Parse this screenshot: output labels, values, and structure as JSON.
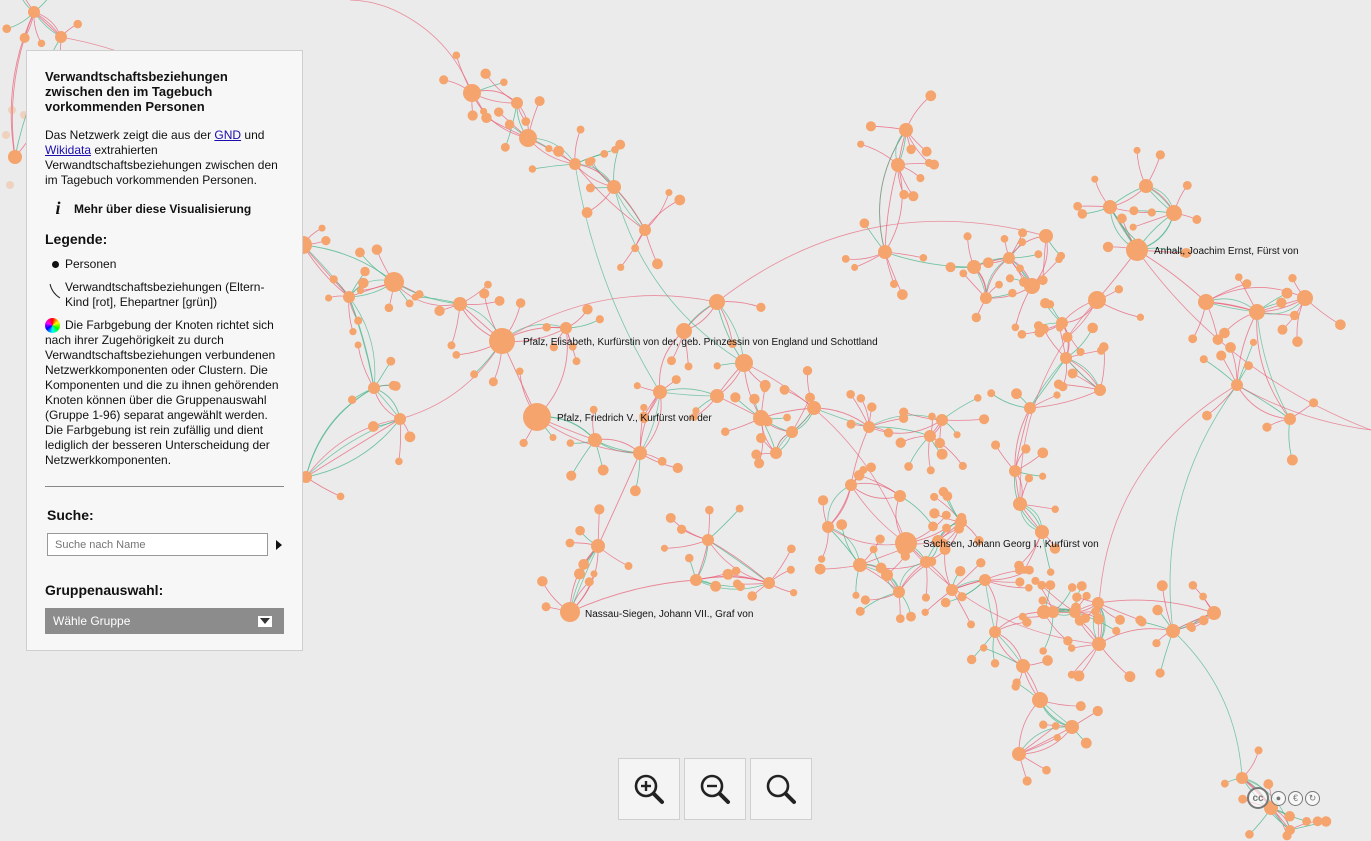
{
  "panel": {
    "title": "Verwandtschaftsbeziehungen zwischen den im Tagebuch vorkommenden Personen",
    "intro_prefix": "Das Netzwerk zeigt die aus der ",
    "link_gnd": "GND",
    "intro_and": " und ",
    "link_wikidata": "Wikidata",
    "intro_suffix": " extrahierten Verwandtschaftsbeziehungen zwischen den im Tagebuch vorkommenden Personen.",
    "more_info": "Mehr über diese Visualisierung",
    "legend_title": "Legende:",
    "legend_persons": "Personen",
    "legend_relations": "Verwandtschaftsbeziehungen (Eltern-Kind [rot], Ehepartner [grün])",
    "legend_colors": "Die Farbgebung der Knoten richtet sich nach ihrer Zugehörigkeit zu durch Verwandtschaftsbeziehungen verbundenen Netzwerkkomponenten oder Clustern. Die Komponenten und die zu ihnen gehörenden Knoten können über die Gruppenauswahl (Gruppe 1-96) separat angewählt werden. Die Farbgebung ist rein zufällig und dient lediglich der besseren Unterscheidung der Netzwerkkomponenten.",
    "search_label": "Suche:",
    "search_placeholder": "Suche nach Name",
    "group_label": "Gruppenauswahl:",
    "group_select": "Wähle Gruppe"
  },
  "graph": {
    "node_color": "#f4a46c",
    "edge_parent_child_color": "#e8647a",
    "edge_spouse_color": "#49b58a",
    "labels": [
      "Pfalz, Elisabeth, Kurfürstin von der, geb. Prinzessin von England und Schottland",
      "Pfalz, Friedrich V., Kurfürst von der",
      "Anhalt, Joachim Ernst, Fürst von",
      "Sachsen, Johann Georg I., Kurfürst von",
      "Nassau-Siegen, Johann VII., Graf von"
    ]
  },
  "zoom": {
    "in": "zoom-in",
    "out": "zoom-out",
    "reset": "zoom-reset"
  },
  "license": {
    "cc": "cc"
  }
}
